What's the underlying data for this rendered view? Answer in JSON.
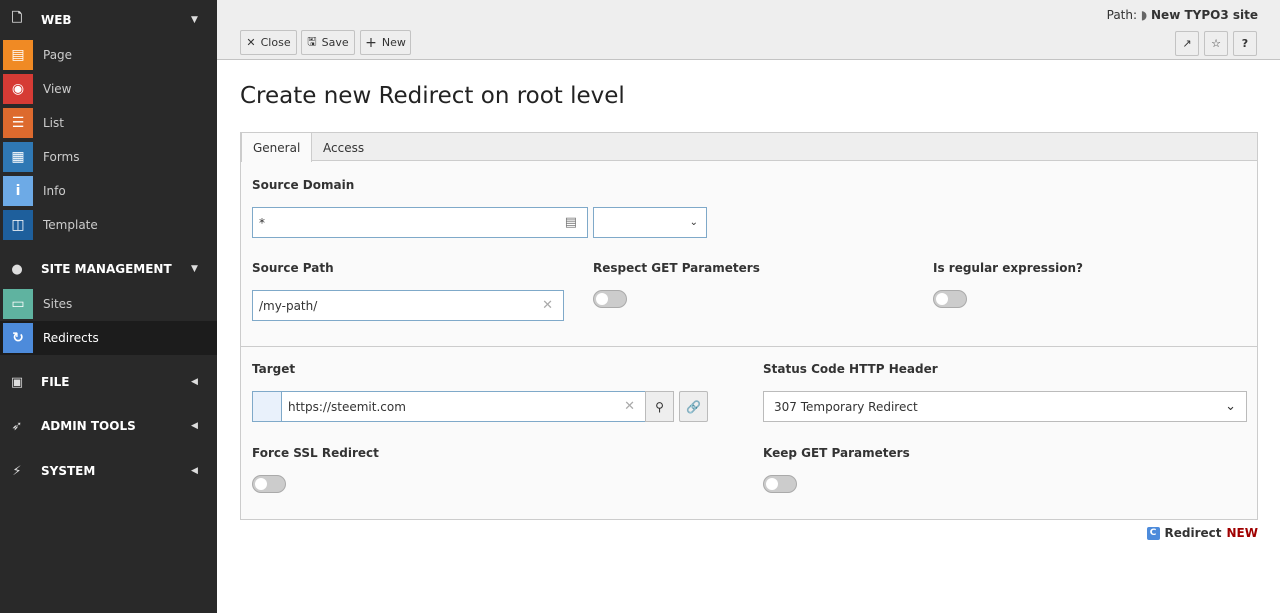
{
  "sidebar": {
    "groups": [
      {
        "label": "WEB",
        "icon": "file-icon"
      },
      {
        "label": "SITE MANAGEMENT",
        "icon": "globe-icon"
      },
      {
        "label": "FILE",
        "icon": "image-icon"
      },
      {
        "label": "ADMIN TOOLS",
        "icon": "rocket-icon"
      },
      {
        "label": "SYSTEM",
        "icon": "plug-icon"
      }
    ],
    "items": [
      {
        "label": "Page",
        "color": "#f08a24"
      },
      {
        "label": "View",
        "color": "#d63b35"
      },
      {
        "label": "List",
        "color": "#dd6a2e"
      },
      {
        "label": "Forms",
        "color": "#2f78b4"
      },
      {
        "label": "Info",
        "color": "#6daae6"
      },
      {
        "label": "Template",
        "color": "#1e5f9c"
      },
      {
        "label": "Sites",
        "color": "#5fb3a0"
      },
      {
        "label": "Redirects",
        "color": "#4d8bdb",
        "active": true
      }
    ]
  },
  "toolbar": {
    "close": "Close",
    "save": "Save",
    "new": "New"
  },
  "path": {
    "label": "Path:",
    "site": "New TYPO3 site"
  },
  "page_title": "Create new Redirect on root level",
  "tabs": [
    "General",
    "Access"
  ],
  "form": {
    "source_domain": {
      "label": "Source Domain",
      "value": "*"
    },
    "source_path": {
      "label": "Source Path",
      "value": "/my-path/"
    },
    "respect_get": {
      "label": "Respect GET Parameters",
      "on": false
    },
    "regex": {
      "label": "Is regular expression?",
      "on": false
    },
    "target": {
      "label": "Target",
      "value": "https://steemit.com"
    },
    "status_code": {
      "label": "Status Code HTTP Header",
      "value": "307 Temporary Redirect"
    },
    "force_ssl": {
      "label": "Force SSL Redirect",
      "on": false
    },
    "keep_get": {
      "label": "Keep GET Parameters",
      "on": false
    }
  },
  "footer": {
    "record_type": "Redirect",
    "state": "NEW",
    "state_color": "#a00000"
  }
}
